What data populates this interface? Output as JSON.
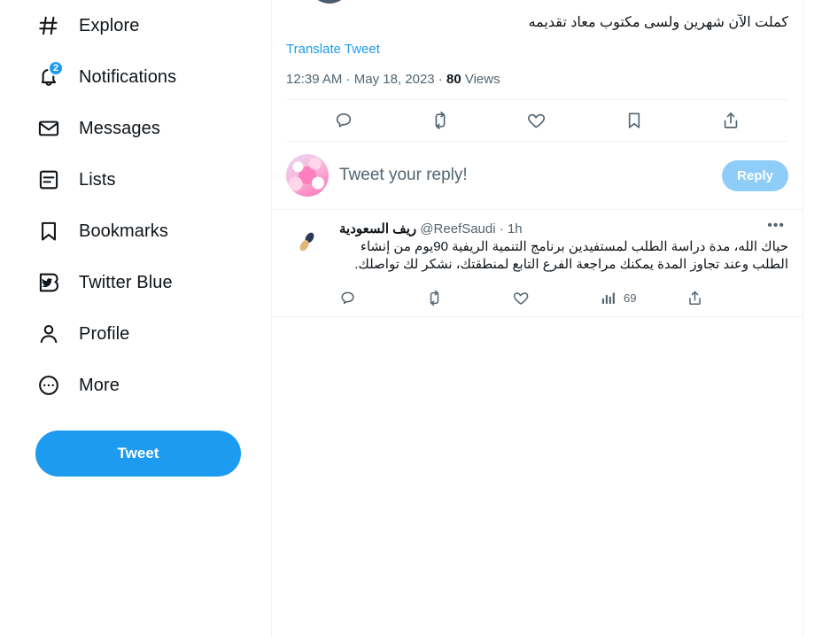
{
  "sidebar": {
    "items": [
      {
        "label": "Explore",
        "icon": "hashtag-icon",
        "badge": null
      },
      {
        "label": "Notifications",
        "icon": "bell-icon",
        "badge": "2"
      },
      {
        "label": "Messages",
        "icon": "envelope-icon",
        "badge": null
      },
      {
        "label": "Lists",
        "icon": "list-icon",
        "badge": null
      },
      {
        "label": "Bookmarks",
        "icon": "bookmark-icon",
        "badge": null
      },
      {
        "label": "Twitter Blue",
        "icon": "twitter-blue-icon",
        "badge": null
      },
      {
        "label": "Profile",
        "icon": "person-icon",
        "badge": null
      },
      {
        "label": "More",
        "icon": "more-circle-icon",
        "badge": null
      }
    ],
    "tweet_button": "Tweet"
  },
  "focus_tweet": {
    "text": "كملت الآن شهرين ولسى مكتوب معاد تقديمه",
    "translate_link": "Translate Tweet",
    "time": "12:39 AM",
    "separator": " · ",
    "date": "May 18, 2023",
    "views_count": "80",
    "views_label": "Views",
    "actions": [
      {
        "name": "reply-icon",
        "count": ""
      },
      {
        "name": "retweet-icon",
        "count": ""
      },
      {
        "name": "like-icon",
        "count": ""
      },
      {
        "name": "bookmark-icon",
        "count": ""
      },
      {
        "name": "share-icon",
        "count": ""
      }
    ]
  },
  "composer": {
    "placeholder": "Tweet your reply!",
    "reply_button": "Reply"
  },
  "reply_tweet": {
    "display_name": "ريف السعودية",
    "handle": "@ReefSaudi",
    "time_separator": " · ",
    "timestamp": "1h",
    "more_menu": "•••",
    "text": "حياك الله، مدة دراسة الطلب لمستفيدين برنامج التنمية الريفية 90يوم من إنشاء الطلب وعند تجاوز المدة يمكنك مراجعة الفرع التابع لمنطقتك، نشكر لك تواصلك.",
    "actions": {
      "reply_count": "",
      "retweet_count": "",
      "like_count": "",
      "views_count": "69",
      "share_count": ""
    }
  },
  "colors": {
    "accent": "#1d9bf0",
    "accent_disabled": "#8ecdf8",
    "text_primary": "#0f1419",
    "text_secondary": "#536471",
    "border": "#eff3f4"
  }
}
